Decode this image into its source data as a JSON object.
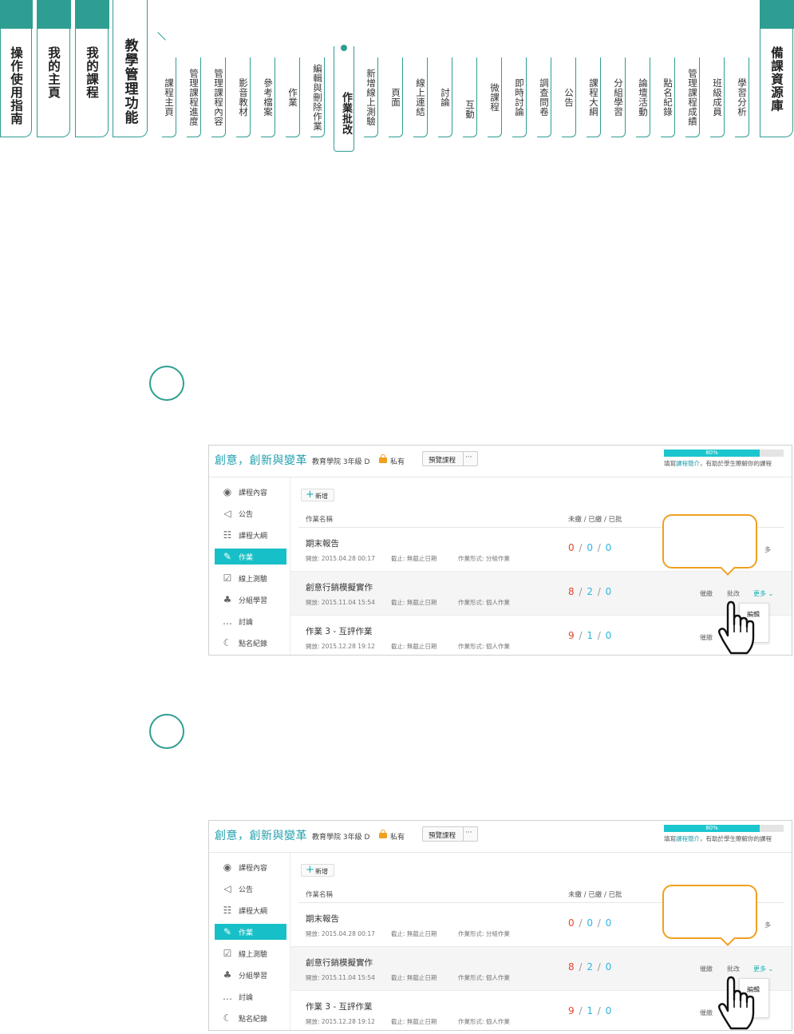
{
  "main_tabs": [
    "操作使用指南",
    "我的主頁",
    "我的課程",
    "教學管理功能"
  ],
  "sub_tabs": [
    "課程主頁",
    "管理課程進度",
    "管理課程內容",
    "影音教材",
    "參考檔案",
    "作業",
    "編輯與刪除作業",
    "作業批改",
    "新增線上測驗",
    "頁面",
    "線上連結",
    "討論",
    "互動",
    "微課程",
    "即時討論",
    "調查問卷",
    "公告",
    "課程大綱",
    "分組學習",
    "論壇活動",
    "點名紀錄",
    "管理課程成績",
    "班級成員",
    "學習分析"
  ],
  "active_sub_tab": "作業批改",
  "right_tab": "備課資源庫",
  "course": {
    "title": "創意，創新與變革",
    "college": "教育學院 3年級 D",
    "privacy": "私有",
    "preview_button": "預覽課程",
    "more_button": "···",
    "progress_label": "80%",
    "progress_value": 0.8,
    "hint_prefix": "填寫",
    "hint_link": "課程簡介",
    "hint_suffix": "，有助於學生瞭解你的課程"
  },
  "sidebar": [
    {
      "icon": "course-content-icon",
      "glyph": "◉",
      "label": "課程內容"
    },
    {
      "icon": "megaphone-icon",
      "glyph": "◁",
      "label": "公告"
    },
    {
      "icon": "syllabus-icon",
      "glyph": "☷",
      "label": "課程大綱"
    },
    {
      "icon": "homework-icon",
      "glyph": "✎",
      "label": "作業"
    },
    {
      "icon": "quiz-icon",
      "glyph": "☑",
      "label": "線上測驗"
    },
    {
      "icon": "group-icon",
      "glyph": "♣",
      "label": "分組學習"
    },
    {
      "icon": "discussion-icon",
      "glyph": "…",
      "label": "討論"
    },
    {
      "icon": "attendance-icon",
      "glyph": "☾",
      "label": "點名紀錄"
    }
  ],
  "active_sidebar": "作業",
  "add_button": "新增",
  "table": {
    "col_name": "作業名稱",
    "col_counts": "未繳 / 已繳 / 已批"
  },
  "homeworks": [
    {
      "name": "期末報告",
      "open_label": "開放:",
      "open": "2015.04.28 00:17",
      "due_label": "截止:",
      "due": "無截止日期",
      "type_label": "作業形式:",
      "type": "分組作業",
      "unsubmitted": "0",
      "submitted": "0",
      "graded": "0"
    },
    {
      "name": "創意行銷模擬實作",
      "open_label": "開放:",
      "open": "2015.11.04 15:54",
      "due_label": "截止:",
      "due": "無截止日期",
      "type_label": "作業形式:",
      "type": "個人作業",
      "unsubmitted": "8",
      "submitted": "2",
      "graded": "0"
    },
    {
      "name": "作業 3 - 互評作業",
      "open_label": "開放:",
      "open": "2015.12.28 19:12",
      "due_label": "截止:",
      "due": "無截止日期",
      "type_label": "作業形式:",
      "type": "個人作業",
      "unsubmitted": "9",
      "submitted": "1",
      "graded": "0"
    }
  ],
  "actions": {
    "remind": "催繳",
    "grade": "批改",
    "more": "更多",
    "edit": "編輯",
    "more_partial": "多"
  },
  "colors": {
    "teal": "#2e9e92",
    "accent": "#17c0c8",
    "callout": "#f0a020",
    "red": "#e8452e",
    "blue": "#2db5e0"
  }
}
